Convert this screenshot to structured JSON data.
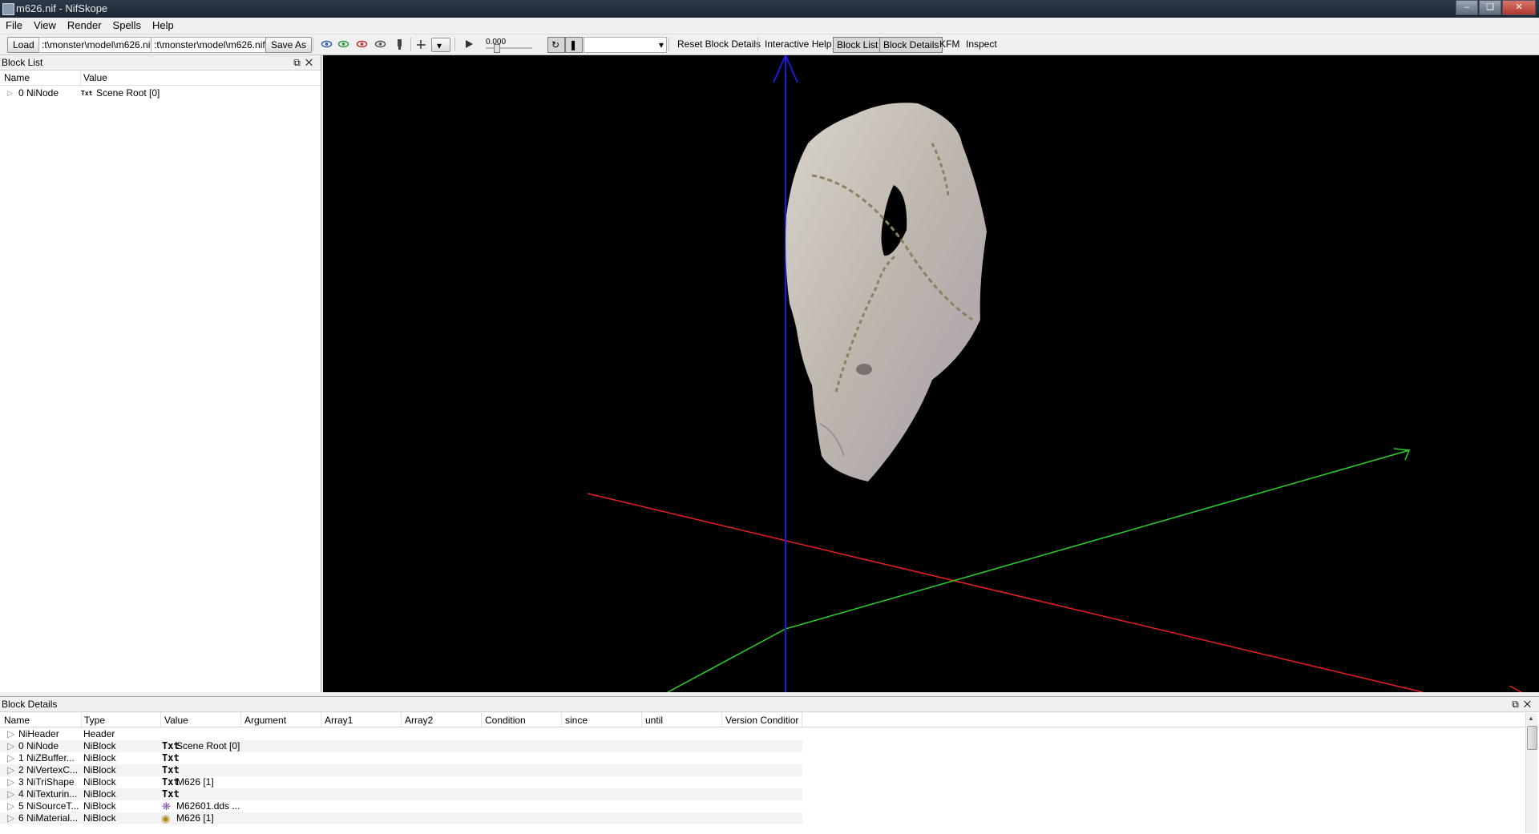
{
  "window": {
    "title": "m626.nif - NifSkope"
  },
  "menu": [
    "File",
    "View",
    "Render",
    "Spells",
    "Help"
  ],
  "toolbar": {
    "load_label": "Load",
    "load_path": ":t\\monster\\model\\m626.nif",
    "save_path": ":t\\monster\\model\\m626.nif",
    "save_as_label": "Save As",
    "time_value": "0.000",
    "reset_label": "Reset Block Details",
    "help_label": "Interactive Help",
    "block_list_label": "Block List",
    "block_details_label": "Block Details",
    "kfm_label": "KFM",
    "inspect_label": "Inspect"
  },
  "block_list": {
    "title": "Block List",
    "columns": [
      "Name",
      "Value"
    ],
    "rows": [
      {
        "name": "0 NiNode",
        "icon": "Txt",
        "value": "Scene Root [0]"
      }
    ]
  },
  "block_details": {
    "title": "Block Details",
    "columns": [
      "Name",
      "Type",
      "Value",
      "Argument",
      "Array1",
      "Array2",
      "Condition",
      "since",
      "until",
      "Version Conditior"
    ],
    "rows": [
      {
        "name": "NiHeader",
        "type": "Header",
        "icon": "",
        "value": ""
      },
      {
        "name": "0 NiNode",
        "type": "NiBlock",
        "icon": "Txt",
        "value": "Scene Root [0]"
      },
      {
        "name": "1 NiZBuffer...",
        "type": "NiBlock",
        "icon": "Txt",
        "value": ""
      },
      {
        "name": "2 NiVertexC...",
        "type": "NiBlock",
        "icon": "Txt",
        "value": ""
      },
      {
        "name": "3 NiTriShape",
        "type": "NiBlock",
        "icon": "Txt",
        "value": "M626 [1]"
      },
      {
        "name": "4 NiTexturin...",
        "type": "NiBlock",
        "icon": "Txt",
        "value": ""
      },
      {
        "name": "5 NiSourceT...",
        "type": "NiBlock",
        "icon": "texture-icon",
        "value": "M62601.dds ..."
      },
      {
        "name": "6 NiMaterial...",
        "type": "NiBlock",
        "icon": "material-icon",
        "value": "M626 [1]"
      }
    ]
  },
  "colors": {
    "x_axis": "#e8201e",
    "y_axis": "#2bd12b",
    "z_axis": "#1a1adb"
  }
}
